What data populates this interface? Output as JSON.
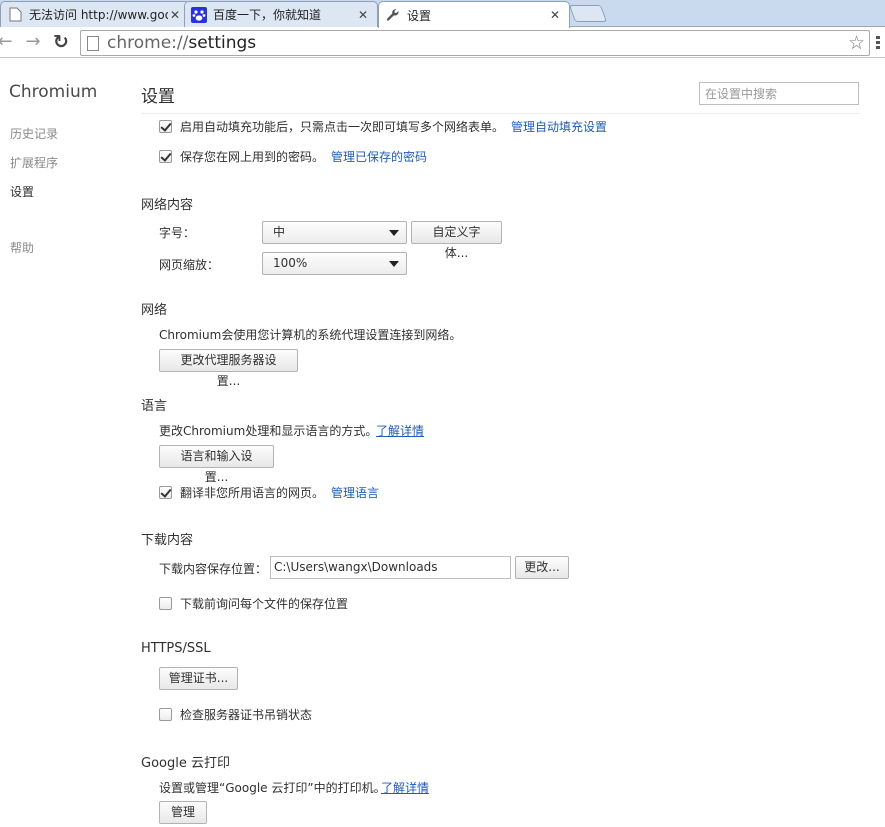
{
  "tabs": [
    {
      "title": "无法访问 http://www.goo",
      "close": "✕"
    },
    {
      "title": "百度一下，你就知道",
      "close": "✕"
    },
    {
      "title": "设置",
      "close": "✕"
    }
  ],
  "toolbar": {
    "back": "←",
    "forward": "→",
    "reload": "↻",
    "url_scheme": "chrome://",
    "url_host": "settings",
    "star": "☆"
  },
  "sidebar": {
    "brand": "Chromium",
    "items": [
      {
        "label": "历史记录"
      },
      {
        "label": "扩展程序"
      },
      {
        "label": "设置"
      },
      {
        "label": "帮助"
      }
    ]
  },
  "header": {
    "title": "设置",
    "search_placeholder": "在设置中搜索"
  },
  "autofill": {
    "autofill_label": "启用自动填充功能后，只需点击一次即可填写多个网络表单。",
    "autofill_link": "管理自动填充设置",
    "password_label": "保存您在网上用到的密码。",
    "password_link": "管理已保存的密码"
  },
  "web_content": {
    "title": "网络内容",
    "font_size_label": "字号：",
    "font_size_value": "中",
    "custom_fonts_button": "自定义字体...",
    "zoom_label": "网页缩放：",
    "zoom_value": "100%"
  },
  "network": {
    "title": "网络",
    "description": "Chromium会使用您计算机的系统代理设置连接到网络。",
    "proxy_button": "更改代理服务器设置..."
  },
  "languages": {
    "title": "语言",
    "description": "更改Chromium处理和显示语言的方式。",
    "learn_more": "了解详情",
    "settings_button": "语言和输入设置...",
    "translate_label": "翻译非您所用语言的网页。",
    "translate_link": "管理语言"
  },
  "downloads": {
    "title": "下载内容",
    "location_label": "下载内容保存位置：",
    "location_value": "C:\\Users\\wangx\\Downloads",
    "change_button": "更改...",
    "ask_label": "下载前询问每个文件的保存位置"
  },
  "https": {
    "title": "HTTPS/SSL",
    "certs_button": "管理证书...",
    "revocation_label": "检查服务器证书吊销状态"
  },
  "cloud_print": {
    "title": "Google 云打印",
    "description": "设置或管理“Google 云打印”中的打印机。",
    "learn_more": "了解详情",
    "manage_button": "管理"
  }
}
